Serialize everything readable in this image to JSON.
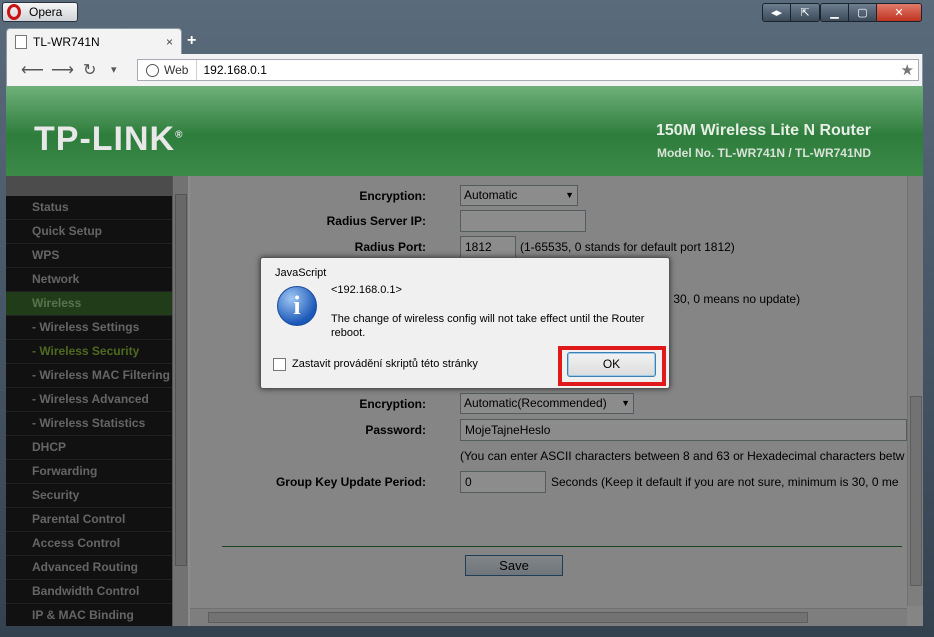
{
  "browser": {
    "menu_label": "Opera",
    "tab_title": "TL-WR741N",
    "tab_close": "×",
    "new_tab": "+",
    "web_badge": "Web",
    "url": "192.168.0.1",
    "nav_icons": [
      "back-icon",
      "forward-icon",
      "reload-icon",
      "history-dropdown-icon",
      "star-icon"
    ]
  },
  "banner": {
    "logo": "TP-LINK",
    "logo_mark": "®",
    "product": "150M Wireless Lite N Router",
    "model": "Model No. TL-WR741N / TL-WR741ND"
  },
  "sidebar": {
    "items": [
      {
        "label": "Status"
      },
      {
        "label": "Quick Setup"
      },
      {
        "label": "WPS"
      },
      {
        "label": "Network"
      },
      {
        "label": "Wireless"
      },
      {
        "label": "- Wireless Settings"
      },
      {
        "label": "- Wireless Security"
      },
      {
        "label": "- Wireless MAC Filtering"
      },
      {
        "label": "- Wireless Advanced"
      },
      {
        "label": "- Wireless Statistics"
      },
      {
        "label": "DHCP"
      },
      {
        "label": "Forwarding"
      },
      {
        "label": "Security"
      },
      {
        "label": "Parental Control"
      },
      {
        "label": "Access Control"
      },
      {
        "label": "Advanced Routing"
      },
      {
        "label": "Bandwidth Control"
      },
      {
        "label": "IP & MAC Binding"
      }
    ]
  },
  "form": {
    "encryption_label_1": "Encryption:",
    "encryption_value_1": "Automatic",
    "radius_ip_label": "Radius Server IP:",
    "radius_ip_value": "",
    "radius_port_label": "Radius Port:",
    "radius_port_value": "1812",
    "radius_port_hint": "(1-65535, 0 stands for default port 1812)",
    "update_hint_partial": "s 30, 0 means no update)",
    "encryption_label_2": "Encryption:",
    "encryption_value_2": "Automatic(Recommended)",
    "password_label": "Password:",
    "password_value": "MojeTajneHeslo",
    "password_hint": "(You can enter ASCII characters between 8 and 63 or Hexadecimal characters betw",
    "group_key_label": "Group Key Update Period:",
    "group_key_value": "0",
    "group_key_hint": "Seconds (Keep it default if you are not sure, minimum is 30, 0 me",
    "save_label": "Save"
  },
  "dialog": {
    "title": "JavaScript",
    "origin": "<192.168.0.1>",
    "message": "The change of wireless config will not take effect until the Router reboot.",
    "checkbox_label": "Zastavit provádění skriptů této stránky",
    "ok_label": "OK",
    "highlight_color": "#e0191a"
  }
}
